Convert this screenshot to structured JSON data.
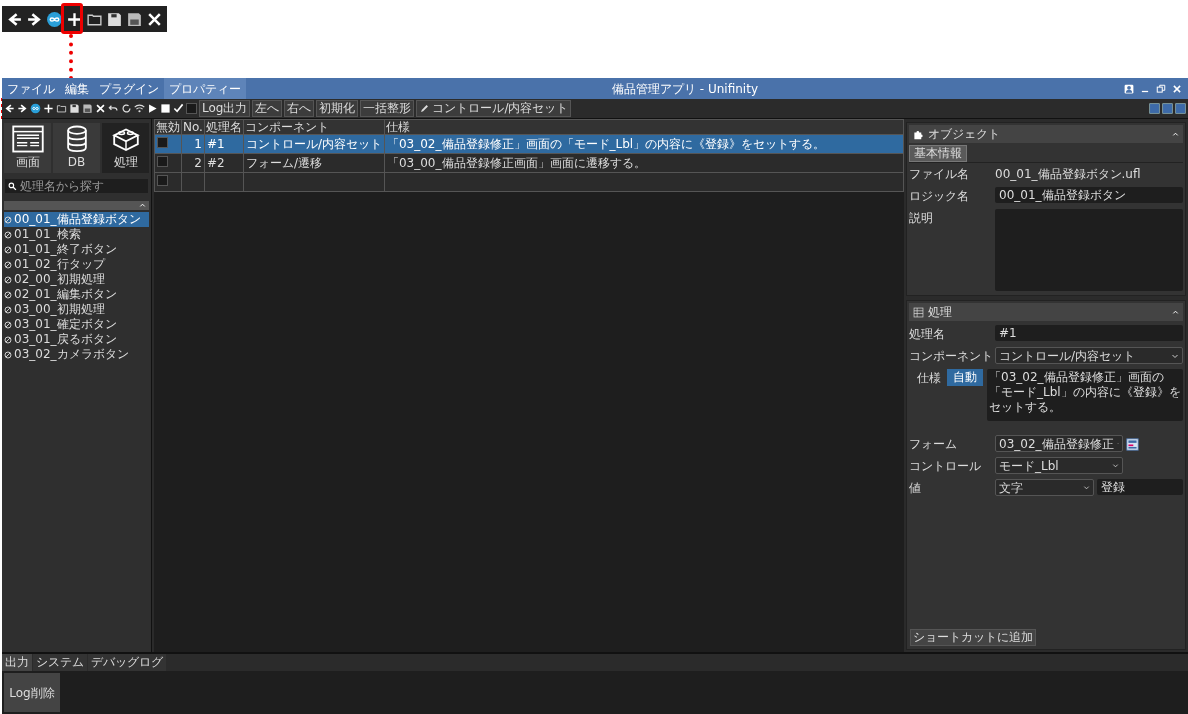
{
  "window": {
    "title": "備品管理アプリ - Unifinity"
  },
  "menu": [
    {
      "label": "ファイル",
      "selected": false
    },
    {
      "label": "編集",
      "selected": false
    },
    {
      "label": "プラグイン",
      "selected": false
    },
    {
      "label": "プロパティー",
      "selected": true
    }
  ],
  "toolbar": {
    "log_checkbox": {
      "label": "Log出力",
      "checked": false
    },
    "buttons": [
      "左へ",
      "右へ",
      "初期化",
      "一括整形",
      "コントロール/内容セット"
    ]
  },
  "categories": [
    {
      "label": "画面",
      "selected": false
    },
    {
      "label": "DB",
      "selected": false
    },
    {
      "label": "処理",
      "selected": true
    }
  ],
  "search": {
    "placeholder": "処理名から探す"
  },
  "process_list": [
    {
      "label": "00_01_備品登録ボタン",
      "selected": true
    },
    {
      "label": "01_01_検索",
      "selected": false
    },
    {
      "label": "01_01_終了ボタン",
      "selected": false
    },
    {
      "label": "01_02_行タップ",
      "selected": false
    },
    {
      "label": "02_00_初期処理",
      "selected": false
    },
    {
      "label": "02_01_編集ボタン",
      "selected": false
    },
    {
      "label": "03_00_初期処理",
      "selected": false
    },
    {
      "label": "03_01_確定ボタン",
      "selected": false
    },
    {
      "label": "03_01_戻るボタン",
      "selected": false
    },
    {
      "label": "03_02_カメラボタン",
      "selected": false
    }
  ],
  "table": {
    "columns": [
      "無効",
      "No.",
      "処理名",
      "コンポーネント",
      "仕様"
    ],
    "rows": [
      {
        "checked": false,
        "no": "1",
        "name": "#1",
        "component": "コントロール/内容セット",
        "spec": "「03_02_備品登録修正」画面の「モード_Lbl」の内容に《登録》をセットする。",
        "selected": true
      },
      {
        "checked": false,
        "no": "2",
        "name": "#2",
        "component": "フォーム/遷移",
        "spec": "「03_00_備品登録修正画面」画面に遷移する。",
        "selected": false
      }
    ],
    "new_row": {
      "checked": false
    }
  },
  "object_panel": {
    "title": "オブジェクト",
    "tabs": [
      {
        "label": "基本情報",
        "selected": true
      }
    ],
    "fields": [
      {
        "label": "ファイル名",
        "value": "00_01_備品登録ボタン.ufl",
        "kind": "text"
      },
      {
        "label": "ロジック名",
        "value": "00_01_備品登録ボタン",
        "kind": "input"
      },
      {
        "label": "説明",
        "kind": "textarea"
      }
    ]
  },
  "process_panel": {
    "title": "処理",
    "name_label": "処理名",
    "name_value": "#1",
    "component_label": "コンポーネント",
    "component_value": "コントロール/内容セット",
    "spec_label": "仕様",
    "auto_button": "自動",
    "spec_value": "「03_02_備品登録修正」画面の「モード_Lbl」の内容に《登録》をセットする。",
    "form_label": "フォーム",
    "form_value": "03_02_備品登録修正",
    "control_label": "コントロール",
    "control_value": "モード_Lbl",
    "value_label": "値",
    "value_type": "文字",
    "value": "登録",
    "shortcut_button": "ショートカットに追加"
  },
  "output": {
    "tabs": [
      {
        "label": "出力",
        "selected": true
      },
      {
        "label": "システム",
        "selected": false
      },
      {
        "label": "デバッグログ",
        "selected": false
      }
    ],
    "clear_button": "Log削除"
  }
}
